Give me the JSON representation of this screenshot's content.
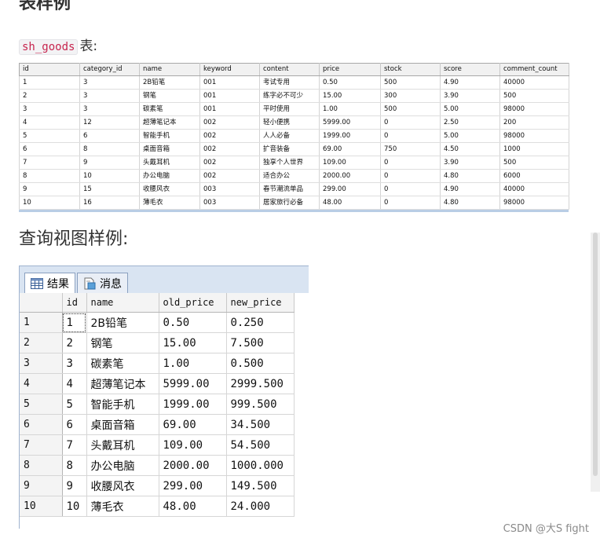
{
  "heading_top": "表样例",
  "subtitle": {
    "code": "sh_goods",
    "suffix": "表:"
  },
  "goods": {
    "columns": [
      "id",
      "category_id",
      "name",
      "keyword",
      "content",
      "price",
      "stock",
      "score",
      "comment_count"
    ],
    "rows": [
      [
        "1",
        "3",
        "2B铅笔",
        "001",
        "考试专用",
        "0.50",
        "500",
        "4.90",
        "40000"
      ],
      [
        "2",
        "3",
        "钢笔",
        "001",
        "练字必不可少",
        "15.00",
        "300",
        "3.90",
        "500"
      ],
      [
        "3",
        "3",
        "碳素笔",
        "001",
        "平时使用",
        "1.00",
        "500",
        "5.00",
        "98000"
      ],
      [
        "4",
        "12",
        "超薄笔记本",
        "002",
        "轻小便携",
        "5999.00",
        "0",
        "2.50",
        "200"
      ],
      [
        "5",
        "6",
        "智能手机",
        "002",
        "人人必备",
        "1999.00",
        "0",
        "5.00",
        "98000"
      ],
      [
        "6",
        "8",
        "桌面音箱",
        "002",
        "扩音装备",
        "69.00",
        "750",
        "4.50",
        "1000"
      ],
      [
        "7",
        "9",
        "头戴耳机",
        "002",
        "独享个人世界",
        "109.00",
        "0",
        "3.90",
        "500"
      ],
      [
        "8",
        "10",
        "办公电脑",
        "002",
        "适合办公",
        "2000.00",
        "0",
        "4.80",
        "6000"
      ],
      [
        "9",
        "15",
        "收腰风衣",
        "003",
        "春节潮流单品",
        "299.00",
        "0",
        "4.90",
        "40000"
      ],
      [
        "10",
        "16",
        "薄毛衣",
        "003",
        "居家旅行必备",
        "48.00",
        "0",
        "4.80",
        "98000"
      ]
    ]
  },
  "heading_view": "查询视图样例:",
  "result": {
    "tabs": [
      {
        "label": "结果",
        "icon": "grid-icon",
        "active": true
      },
      {
        "label": "消息",
        "icon": "message-doc-icon",
        "active": false
      }
    ],
    "columns": [
      "id",
      "name",
      "old_price",
      "new_price"
    ],
    "rows": [
      [
        "1",
        "1",
        "2B铅笔",
        "0.50",
        "0.250"
      ],
      [
        "2",
        "2",
        "钢笔",
        "15.00",
        "7.500"
      ],
      [
        "3",
        "3",
        "碳素笔",
        "1.00",
        "0.500"
      ],
      [
        "4",
        "4",
        "超薄笔记本",
        "5999.00",
        "2999.500"
      ],
      [
        "5",
        "5",
        "智能手机",
        "1999.00",
        "999.500"
      ],
      [
        "6",
        "6",
        "桌面音箱",
        "69.00",
        "34.500"
      ],
      [
        "7",
        "7",
        "头戴耳机",
        "109.00",
        "54.500"
      ],
      [
        "8",
        "8",
        "办公电脑",
        "2000.00",
        "1000.000"
      ],
      [
        "9",
        "9",
        "收腰风衣",
        "299.00",
        "149.500"
      ],
      [
        "10",
        "10",
        "薄毛衣",
        "48.00",
        "24.000"
      ]
    ]
  },
  "watermark": "CSDN @大S fight"
}
